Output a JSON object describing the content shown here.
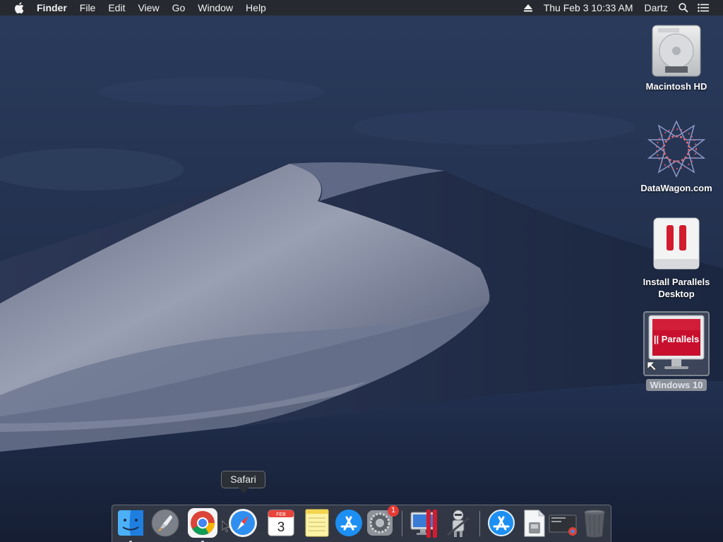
{
  "menubar": {
    "app_name": "Finder",
    "items": [
      "File",
      "Edit",
      "View",
      "Go",
      "Window",
      "Help"
    ],
    "datetime": "Thu Feb 3  10:33 AM",
    "user": "Dartz"
  },
  "desktop": {
    "icons": [
      {
        "label": "Macintosh HD",
        "icon": "hard-drive-icon"
      },
      {
        "label": "DataWagon.com",
        "icon": "network-share-icon"
      },
      {
        "label": "Install Parallels Desktop",
        "icon": "parallels-installer-icon"
      },
      {
        "label": "Windows 10",
        "icon": "parallels-vm-icon",
        "selected": true
      }
    ],
    "vm_screen_text": "|| Parallels"
  },
  "tooltip": {
    "text": "Safari"
  },
  "dock": {
    "apps": [
      {
        "name": "Finder",
        "icon": "finder-icon",
        "running": true
      },
      {
        "name": "Launchpad",
        "icon": "launchpad-icon",
        "running": false
      },
      {
        "name": "Google Chrome",
        "icon": "chrome-icon",
        "running": true
      },
      {
        "name": "Safari",
        "icon": "safari-icon",
        "running": false
      },
      {
        "name": "Calendar",
        "icon": "calendar-icon",
        "running": false,
        "month": "FEB",
        "day": "3"
      },
      {
        "name": "Notes",
        "icon": "notes-icon",
        "running": false
      },
      {
        "name": "App Store",
        "icon": "app-store-icon",
        "running": false
      },
      {
        "name": "System Preferences",
        "icon": "system-preferences-icon",
        "running": false,
        "badge": "1"
      },
      {
        "name": "Parallels Desktop",
        "icon": "parallels-desktop-icon",
        "running": false
      },
      {
        "name": "Automator",
        "icon": "automator-icon",
        "running": false
      },
      {
        "name": "Applications",
        "icon": "applications-folder-icon",
        "running": false
      },
      {
        "name": "Documents",
        "icon": "documents-stack-icon",
        "running": false
      },
      {
        "name": "Downloads",
        "icon": "downloads-stack-icon",
        "running": false
      },
      {
        "name": "Trash",
        "icon": "trash-icon",
        "running": false
      }
    ]
  },
  "colors": {
    "menubar_bg": "#262a30",
    "wallpaper_sky": "#1f2d4a",
    "dune_light": "#8c93a8",
    "badge_red": "#e53a35",
    "parallels_red": "#c8102e"
  }
}
